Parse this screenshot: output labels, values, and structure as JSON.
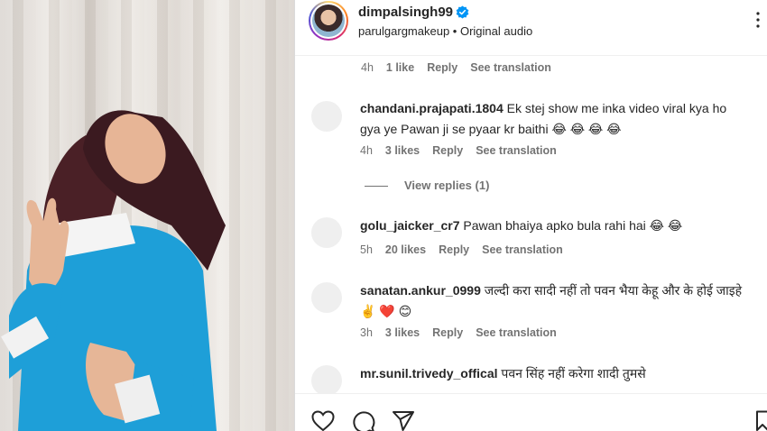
{
  "post": {
    "username": "dimpalsingh99",
    "audio_owner": "parulgargmakeup",
    "audio_separator": " • ",
    "audio_label": "Original audio"
  },
  "top_meta": {
    "time": "4h",
    "likes": "1 like",
    "reply": "Reply",
    "translate": "See translation"
  },
  "comments": [
    {
      "user": "chandani.prajapati.1804",
      "text": "Ek stej show me inka video viral kya ho gya ye Pawan ji se pyaar kr baithi 😂 😂 😂 😂",
      "time": "4h",
      "likes": "3 likes",
      "reply": "Reply",
      "translate": "See translation",
      "view_replies": "View replies (1)"
    },
    {
      "user": "golu_jaicker_cr7",
      "text": "Pawan bhaiya apko bula rahi hai 😂 😂",
      "time": "5h",
      "likes": "20 likes",
      "reply": "Reply",
      "translate": "See translation"
    },
    {
      "user": "sanatan.ankur_0999",
      "text": "जल्दी करा सादी नहीं तो पवन भैया केहू और के होई जाइहे ✌️ ❤️ 😊",
      "time": "3h",
      "likes": "3 likes",
      "reply": "Reply",
      "translate": "See translation"
    },
    {
      "user": "mr.sunil.trivedy_offical",
      "text": "पवन सिंह नहीं करेगा शादी तुमसे"
    }
  ],
  "colors": {
    "verified": "#0095f6",
    "muted": "#737373",
    "text": "#262626"
  },
  "icons": [
    "heart-icon",
    "comment-icon",
    "share-icon",
    "save-icon",
    "more-options-icon",
    "verified-badge-icon"
  ]
}
